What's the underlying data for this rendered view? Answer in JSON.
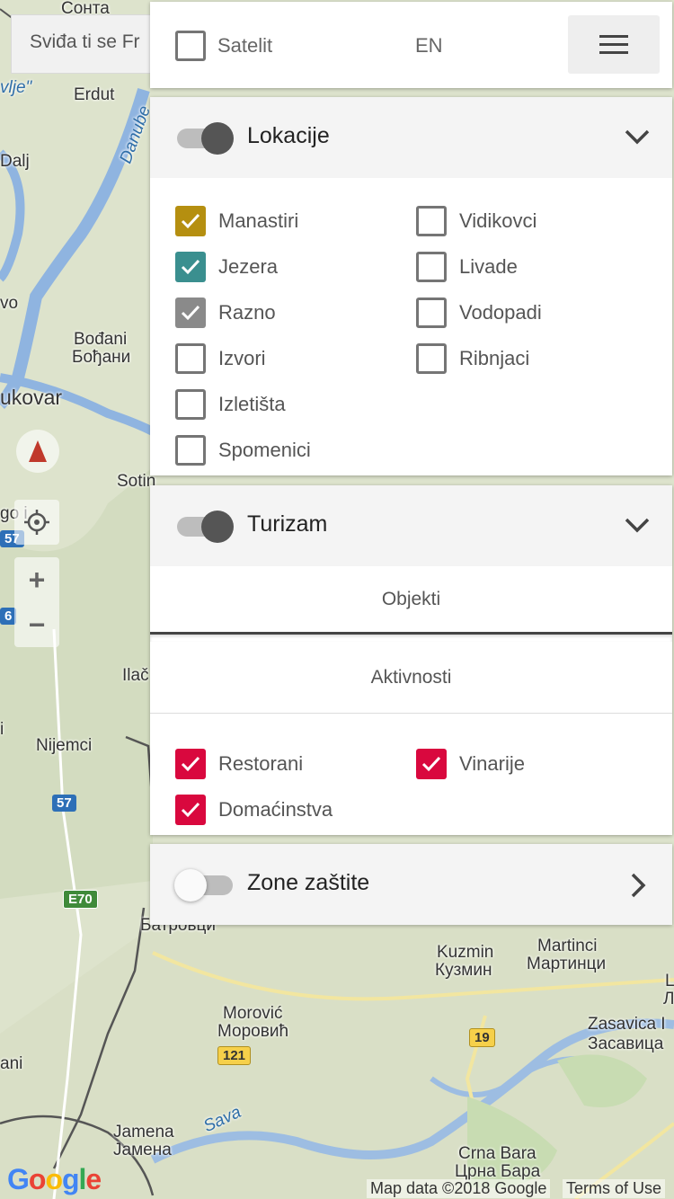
{
  "map": {
    "fb_like_text": "Sviđa ti se Fr",
    "labels": {
      "sonta": "Сонта",
      "erdut": "Erdut",
      "dalj": "Dalj",
      "danube": "Danube",
      "vo": "vo",
      "bodjani_lat": "Bođani",
      "bodjani_cyr": "Бођани",
      "vukovar": "ukovar",
      "sotin": "Sotin",
      "gorjani": "go i",
      "ilac": "Ilač",
      "nijemci": "Nijemci",
      "batrovci": "Батровци",
      "kuzmin_lat": "Kuzmin",
      "kuzmin_cyr": "Кузмин",
      "martinci_lat": "Martinci",
      "martinci_cyr": "Мартинци",
      "morovic_lat": "Morović",
      "morovic_cyr": "Моровић",
      "zasavica_lat": "Zasavica I",
      "zasavica_cyr": "Засавица",
      "jamena_lat": "Jamena",
      "jamena_cyr": "Јамена",
      "sava": "Sava",
      "crna_bara_lat": "Crna Bara",
      "crna_bara_cyr": "Црна Бара",
      "edge_l1": "L",
      "edge_l2": "Л",
      "ani": "ani",
      "i_left": "i",
      "vlje": "vlje\""
    },
    "shields": {
      "s57a": "57",
      "s6": "6",
      "s57b": "57",
      "e70": "E70",
      "s121": "121",
      "s19": "19"
    },
    "google": "Google",
    "map_data": "Map data ©2018 Google",
    "terms": "Terms of Use"
  },
  "topbar": {
    "satellite_label": "Satelit",
    "satellite_checked": false,
    "language": "EN"
  },
  "lokacije": {
    "title": "Lokacije",
    "enabled": true,
    "left_items": [
      {
        "label": "Manastiri",
        "checked": true,
        "color": "#b58f10"
      },
      {
        "label": "Jezera",
        "checked": true,
        "color": "#3a8f8f"
      },
      {
        "label": "Razno",
        "checked": true,
        "color": "#8a8a8a"
      },
      {
        "label": "Izvori",
        "checked": false
      },
      {
        "label": "Izletišta",
        "checked": false
      },
      {
        "label": "Spomenici",
        "checked": false
      }
    ],
    "right_items": [
      {
        "label": "Vidikovci",
        "checked": false
      },
      {
        "label": "Livade",
        "checked": false
      },
      {
        "label": "Vodopadi",
        "checked": false
      },
      {
        "label": "Ribnjaci",
        "checked": false
      }
    ]
  },
  "turizam": {
    "title": "Turizam",
    "enabled": true,
    "tabs": [
      "Objekti",
      "Aktivnosti"
    ],
    "left_items": [
      {
        "label": "Restorani",
        "checked": true,
        "color": "#d9083e"
      },
      {
        "label": "Domaćinstva",
        "checked": true,
        "color": "#d9083e"
      }
    ],
    "right_items": [
      {
        "label": "Vinarije",
        "checked": true,
        "color": "#d9083e"
      }
    ]
  },
  "zone": {
    "title": "Zone zaštite",
    "enabled": false
  }
}
